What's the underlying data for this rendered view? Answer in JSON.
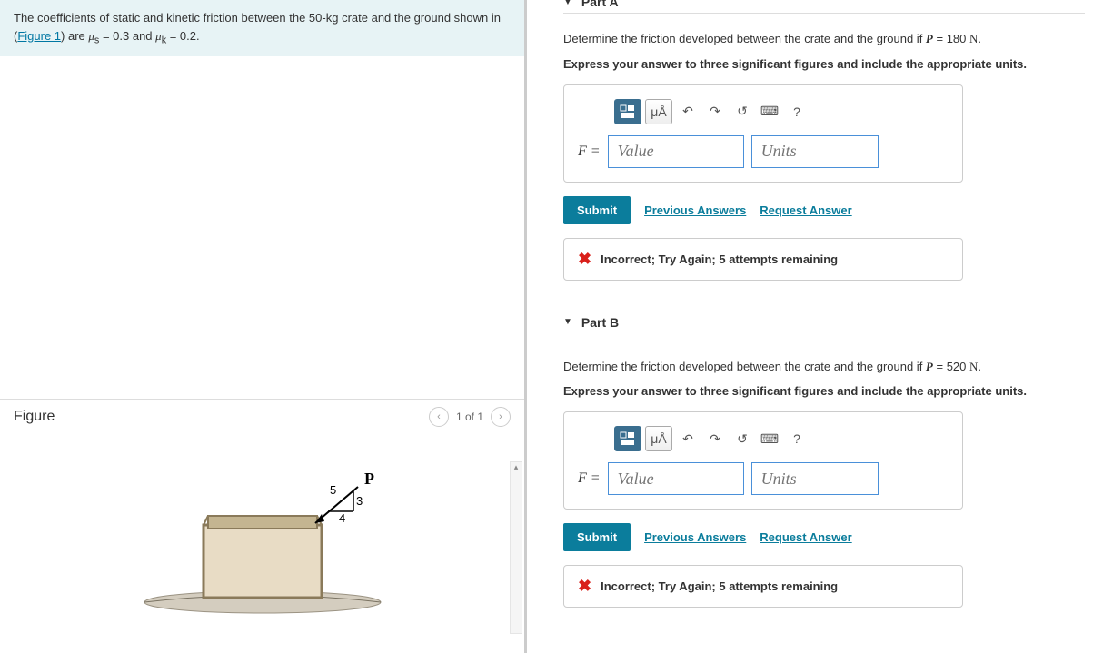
{
  "problem": {
    "text_prefix": "The coefficients of static and kinetic friction between the 50-",
    "text_unit": "kg",
    "text_mid": " crate and the ground shown in (",
    "figure_link": "Figure 1",
    "text_after": ") are ",
    "mu_s": "μ",
    "s_sub": "s",
    "mu_s_val": " = 0.3 and ",
    "mu_k": "μ",
    "k_sub": "k",
    "mu_k_val": " = 0.2."
  },
  "figure": {
    "title": "Figure",
    "nav_text": "1 of 1",
    "label_p": "P",
    "tri_5": "5",
    "tri_3": "3",
    "tri_4": "4"
  },
  "partA": {
    "title": "Part A",
    "question_pre": "Determine the friction developed between the crate and the ground if ",
    "p_var": "P",
    "p_val": " = 180 ",
    "p_unit": "N",
    "p_end": ".",
    "instruction": "Express your answer to three significant figures and include the appropriate units.",
    "toolbar_mu": "μÅ",
    "label": "F = ",
    "value_placeholder": "Value",
    "units_placeholder": "Units",
    "submit": "Submit",
    "prev_answers": "Previous Answers",
    "request_answer": "Request Answer",
    "feedback": "Incorrect; Try Again; 5 attempts remaining"
  },
  "partB": {
    "title": "Part B",
    "question_pre": "Determine the friction developed between the crate and the ground if ",
    "p_var": "P",
    "p_val": " = 520 ",
    "p_unit": "N",
    "p_end": ".",
    "instruction": "Express your answer to three significant figures and include the appropriate units.",
    "toolbar_mu": "μÅ",
    "label": "F = ",
    "value_placeholder": "Value",
    "units_placeholder": "Units",
    "submit": "Submit",
    "prev_answers": "Previous Answers",
    "request_answer": "Request Answer",
    "feedback": "Incorrect; Try Again; 5 attempts remaining"
  },
  "icons": {
    "undo": "↶",
    "redo": "↷",
    "reset": "↺",
    "keyboard": "⌨",
    "help": "?",
    "x": "✖",
    "down": "▼",
    "left": "‹",
    "right": "›",
    "up_tri": "▴"
  }
}
